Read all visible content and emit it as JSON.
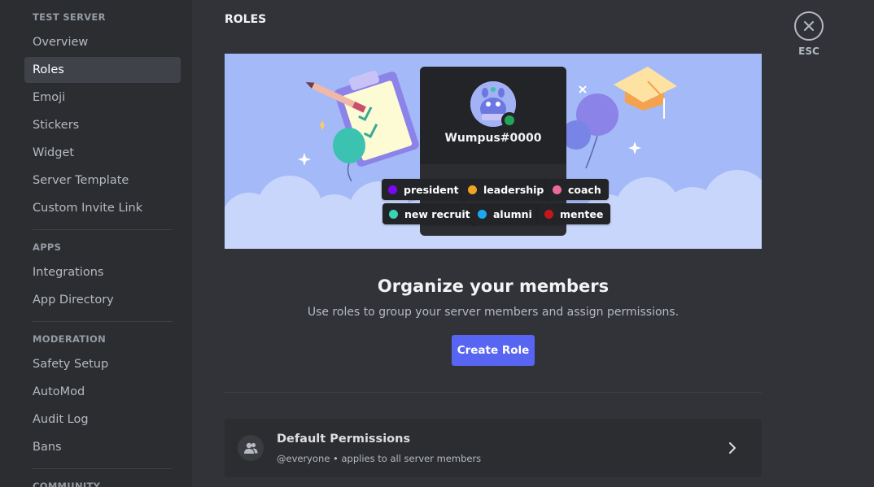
{
  "sidebar": {
    "sections": [
      {
        "header": "TEST SERVER",
        "items": [
          {
            "label": "Overview",
            "selected": false
          },
          {
            "label": "Roles",
            "selected": true
          },
          {
            "label": "Emoji",
            "selected": false
          },
          {
            "label": "Stickers",
            "selected": false
          },
          {
            "label": "Widget",
            "selected": false
          },
          {
            "label": "Server Template",
            "selected": false
          },
          {
            "label": "Custom Invite Link",
            "selected": false
          }
        ]
      },
      {
        "header": "APPS",
        "items": [
          {
            "label": "Integrations",
            "selected": false
          },
          {
            "label": "App Directory",
            "selected": false
          }
        ]
      },
      {
        "header": "MODERATION",
        "items": [
          {
            "label": "Safety Setup",
            "selected": false
          },
          {
            "label": "AutoMod",
            "selected": false
          },
          {
            "label": "Audit Log",
            "selected": false
          },
          {
            "label": "Bans",
            "selected": false
          }
        ]
      },
      {
        "header": "COMMUNITY",
        "items": []
      }
    ]
  },
  "main": {
    "title": "ROLES",
    "banner": {
      "username": "Wumpus#0000",
      "roles": [
        {
          "name": "president",
          "color": "#7c07f2"
        },
        {
          "name": "leadership",
          "color": "#f0a425"
        },
        {
          "name": "coach",
          "color": "#ea6a9b"
        },
        {
          "name": "new recruit",
          "color": "#39d2b4"
        },
        {
          "name": "alumni",
          "color": "#19aaf2"
        },
        {
          "name": "mentee",
          "color": "#c5161d"
        }
      ]
    },
    "heading": "Organize your members",
    "subheading": "Use roles to group your server members and assign permissions.",
    "create_button": "Create Role",
    "default_permissions": {
      "title": "Default Permissions",
      "subtitle": "@everyone • applies to all server members",
      "icon": "members-icon"
    }
  },
  "close": {
    "label": "ESC",
    "icon": "close-icon"
  },
  "colors": {
    "accent": "#5865f2",
    "online": "#23a559"
  }
}
